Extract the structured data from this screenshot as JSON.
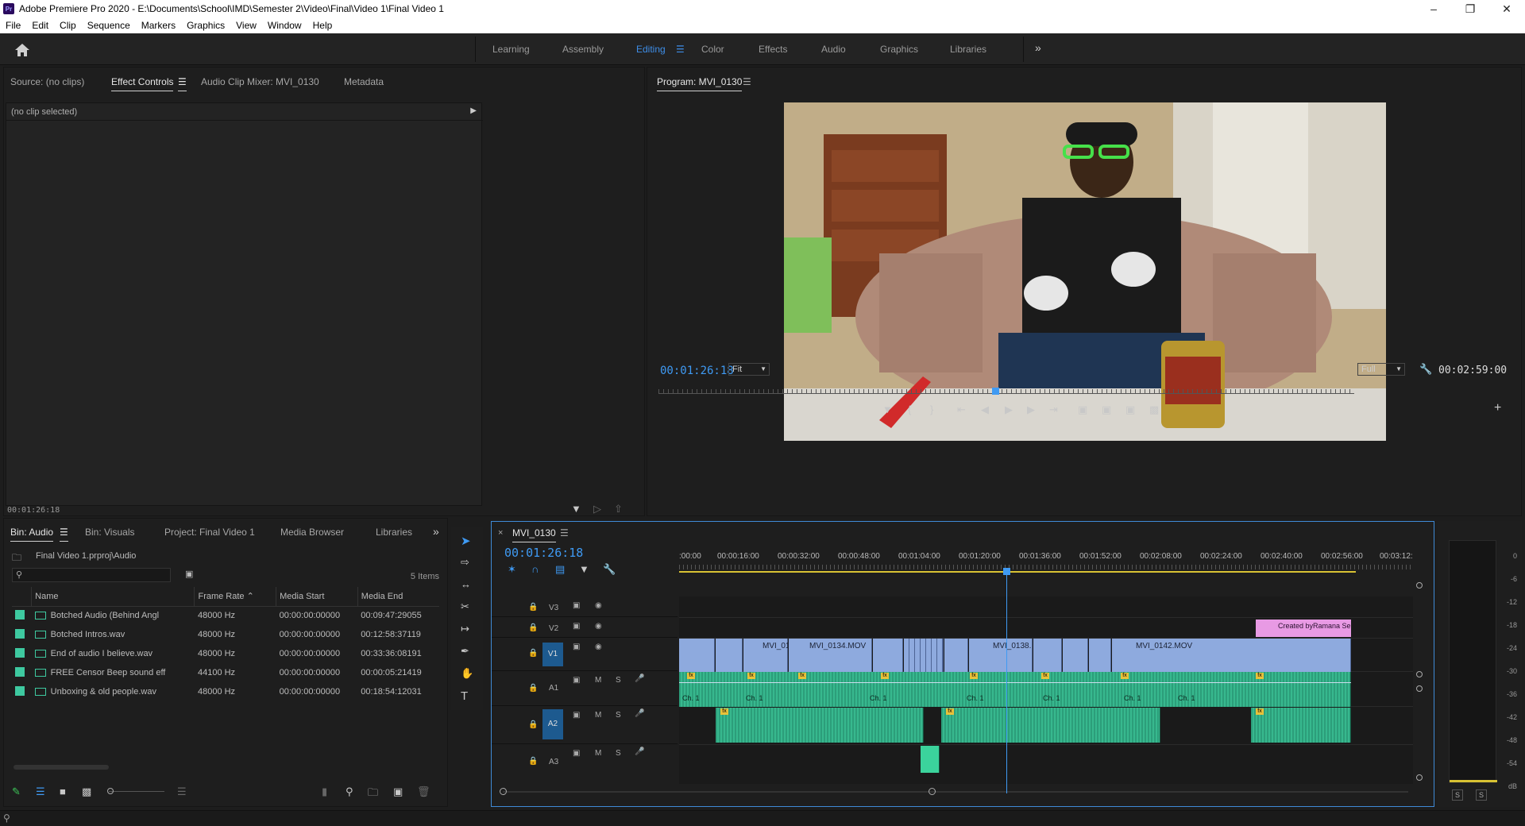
{
  "window": {
    "title": "Adobe Premiere Pro 2020 - E:\\Documents\\School\\IMD\\Semester 2\\Video\\Final\\Video 1\\Final Video 1",
    "app_icon": "Pr"
  },
  "menu": [
    "File",
    "Edit",
    "Clip",
    "Sequence",
    "Markers",
    "Graphics",
    "View",
    "Window",
    "Help"
  ],
  "workspaces": {
    "tabs": [
      "Learning",
      "Assembly",
      "Editing",
      "Color",
      "Effects",
      "Audio",
      "Graphics",
      "Libraries"
    ],
    "active": "Editing",
    "more": "»"
  },
  "source_panel": {
    "tabs": [
      "Source: (no clips)",
      "Effect Controls",
      "Audio Clip Mixer: MVI_0130",
      "Metadata"
    ],
    "active": "Effect Controls",
    "no_clip": "(no clip selected)",
    "timecode": "00:01:26:18"
  },
  "program": {
    "title": "Program: MVI_0130",
    "timecode": "00:01:26:18",
    "fit": "Fit",
    "resolution": "Full",
    "duration": "00:02:59:00",
    "playhead_fraction": 0.484
  },
  "project": {
    "tabs": [
      "Bin: Audio",
      "Bin: Visuals",
      "Project: Final Video 1",
      "Media Browser",
      "Libraries"
    ],
    "active": "Bin: Audio",
    "path": "Final Video 1.prproj\\Audio",
    "item_count": "5 Items",
    "columns": [
      "Name",
      "Frame Rate",
      "Media Start",
      "Media End"
    ],
    "rows": [
      {
        "name": "Botched Audio (Behind Angl",
        "rate": "48000 Hz",
        "start": "00:00:00:00000",
        "end": "00:09:47:29055"
      },
      {
        "name": "Botched Intros.wav",
        "rate": "48000 Hz",
        "start": "00:00:00:00000",
        "end": "00:12:58:37119"
      },
      {
        "name": "End of audio I believe.wav",
        "rate": "48000 Hz",
        "start": "00:00:00:00000",
        "end": "00:33:36:08191"
      },
      {
        "name": "FREE Censor Beep sound eff",
        "rate": "44100 Hz",
        "start": "00:00:00:00000",
        "end": "00:00:05:21419"
      },
      {
        "name": "Unboxing & old people.wav",
        "rate": "48000 Hz",
        "start": "00:00:00:00000",
        "end": "00:18:54:12031"
      }
    ]
  },
  "timeline": {
    "sequence": "MVI_0130",
    "timecode": "00:01:26:18",
    "ruler": [
      ":00:00",
      "00:00:16:00",
      "00:00:32:00",
      "00:00:48:00",
      "00:01:04:00",
      "00:01:20:00",
      "00:01:36:00",
      "00:01:52:00",
      "00:02:08:00",
      "00:02:24:00",
      "00:02:40:00",
      "00:02:56:00",
      "00:03:12:"
    ],
    "tracks": [
      "V3",
      "V2",
      "V1",
      "A1",
      "A2",
      "A3"
    ],
    "clip_labels": [
      "MVI_01",
      "MVI_0134.MOV",
      "MVI_0138.",
      "MVI_0142.MOV"
    ],
    "title_clip": "Created byRamana Se",
    "channel_label": "Ch. 1",
    "mute": "M",
    "solo": "S"
  },
  "meter": {
    "ticks": [
      "0",
      "-6",
      "-12",
      "-18",
      "-24",
      "-30",
      "-36",
      "-42",
      "-48",
      "-54",
      "dB"
    ],
    "solo": "S"
  },
  "colors": {
    "accent": "#3f9af3",
    "video_clip": "#8eaade",
    "audio_clip": "#2c9e7a",
    "title_clip": "#e89ae4",
    "audio_label": "#3ec9a0"
  }
}
